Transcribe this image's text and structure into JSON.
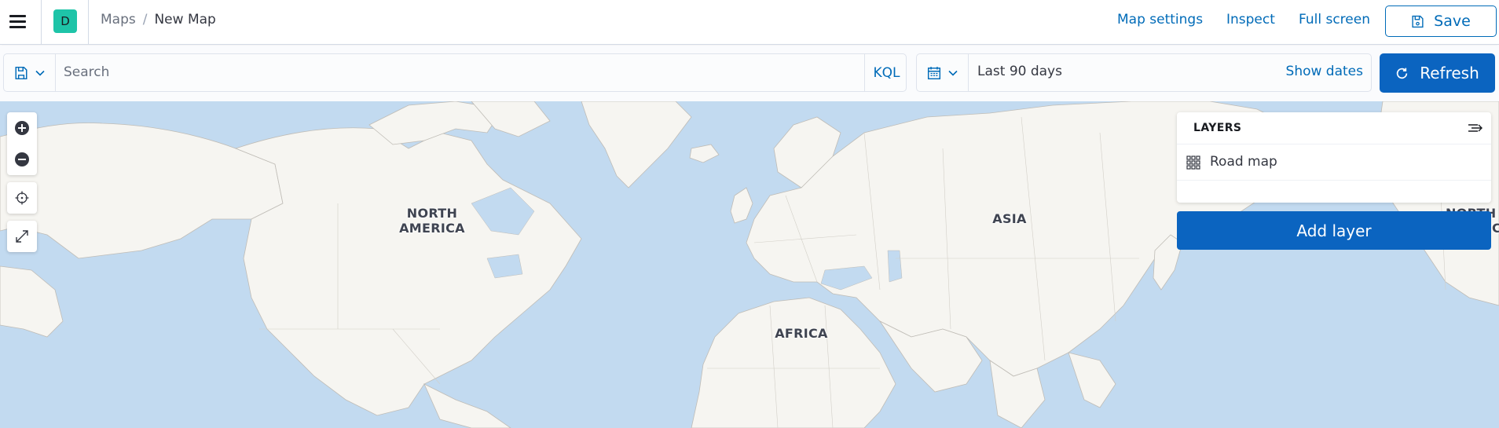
{
  "header": {
    "space_initial": "D",
    "breadcrumbs": [
      {
        "label": "Maps"
      },
      {
        "label": "New Map"
      }
    ],
    "links": {
      "map_settings": "Map settings",
      "inspect": "Inspect",
      "full_screen": "Full screen"
    },
    "save_label": "Save"
  },
  "query_bar": {
    "search_placeholder": "Search",
    "search_value": "",
    "language": "KQL",
    "date_range": "Last 90 days",
    "show_dates": "Show dates",
    "refresh_label": "Refresh"
  },
  "map": {
    "continent_labels": {
      "north_america": "NORTH\nAMERICA",
      "asia": "ASIA",
      "africa": "AFRICA",
      "north_america_wrapped": "NORTH\nAMERIC"
    }
  },
  "layers_panel": {
    "title": "LAYERS",
    "layers": [
      {
        "name": "Road map",
        "icon": "grid-icon"
      }
    ],
    "add_layer_label": "Add layer"
  },
  "colors": {
    "primary": "#0b64c0",
    "link": "#006bb8",
    "water": "#c2daf0",
    "land": "#f6f5f1",
    "space_avatar": "#1ec4a8"
  }
}
